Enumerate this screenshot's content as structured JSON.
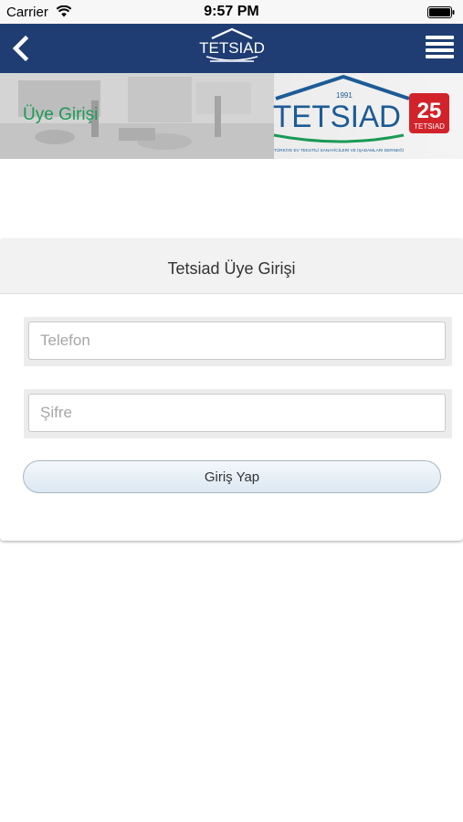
{
  "status_bar": {
    "carrier": "Carrier",
    "time": "9:57 PM"
  },
  "nav": {
    "logo_text": "TETSIAD",
    "back_icon": "chevron-left-icon",
    "menu_icon": "hamburger-menu-icon"
  },
  "banner": {
    "title": "Üye Girişi",
    "logo_year": "1991",
    "logo_name": "TETSIAD",
    "logo_tagline": "TÜRKİYE EV TEKSTİLİ SANAYİCİLERİ VE İŞADAMLARI DERNEĞİ",
    "anniversary_number": "25",
    "anniversary_label": "TETSIAD"
  },
  "login": {
    "header": "Tetsiad Üye Girişi",
    "phone_placeholder": "Telefon",
    "password_placeholder": "Şifre",
    "submit_label": "Giriş Yap"
  },
  "colors": {
    "nav_bg": "#1f3d73",
    "banner_title": "#1b9a55",
    "logo_blue": "#1c5b96",
    "badge_red": "#d2232a"
  }
}
